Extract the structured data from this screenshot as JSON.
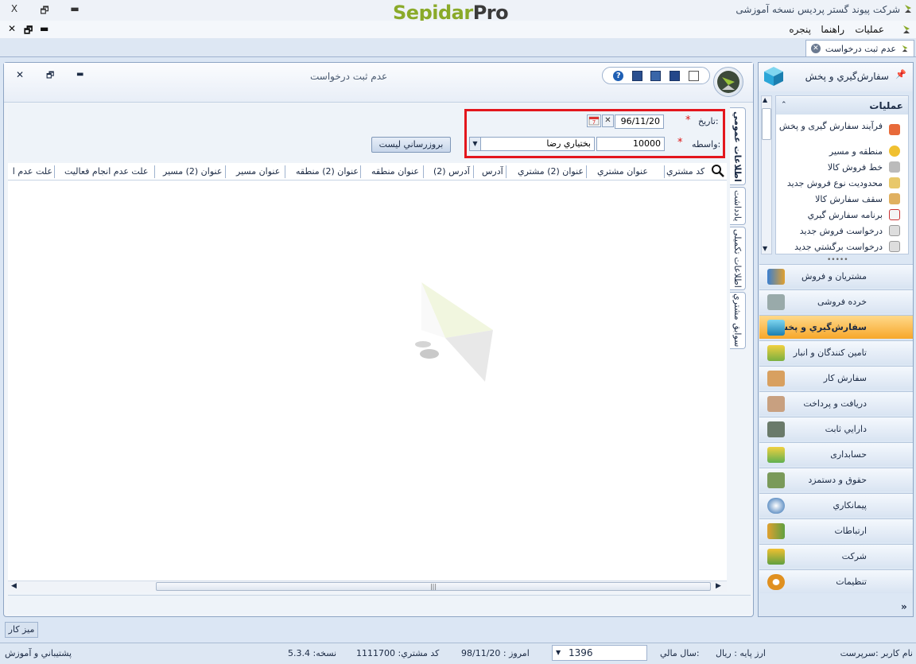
{
  "titlebar": {
    "app_title": "شرکت پیوند گستر پردیس نسخه آموزشی",
    "brand_a": "Sepidar",
    "brand_b": "Pro",
    "close": "X",
    "restore": "🗗",
    "minimize": "▬"
  },
  "menubar": {
    "items": [
      "عملیات",
      "راهنما",
      "پنجره"
    ],
    "mdi_close": "✕",
    "mdi_restore": "🗗",
    "mdi_min": "▬"
  },
  "doc_tab": {
    "label": "عدم ثبت درخواست"
  },
  "window": {
    "title": "عدم ثبت درخواست"
  },
  "filter": {
    "date_label": "تاریخ:",
    "date_value": "96/11/20",
    "agent_label": "واسطه:",
    "agent_code": "10000",
    "agent_name": "بختیاري رضا",
    "required_mark": "*",
    "refresh_button": "بروزرساني ليست"
  },
  "grid": {
    "columns": [
      "کد مشتري",
      "عنوان مشتري",
      "عنوان (2) مشتري",
      "آدرس",
      "آدرس (2)",
      "عنوان منطقه",
      "عنوان (2) منطقه",
      "عنوان مسير",
      "عنوان (2) مسير",
      "علت عدم انجام فعاليت",
      "علت عدم ا"
    ]
  },
  "vertical_tabs": [
    "اطلاعات عمومي",
    "یادداشت",
    "اطلاعات تکمیلی",
    "سوابق مشتري"
  ],
  "right_panel": {
    "title": "سفارش‌گيري و پخش",
    "pin": "📌",
    "ops_header": "عملیات",
    "ops": [
      "فرآیند سفارش گیری و پخش",
      "منطقه و مسير",
      "خط فروش کالا",
      "محدوديت نوع فروش جديد",
      "سقف سفارش کالا",
      "برنامه سفارش گيري",
      "درخواست فروش جديد",
      "درخواست برگشتي جديد"
    ],
    "nav": [
      "مشتريان و فروش",
      "خرده فروشی",
      "سفارش‌گيري و پخش",
      "تامين کنندگان و انبار",
      "سفارش کار",
      "دريافت و پرداخت",
      "دارايي ثابت",
      "حسابداری",
      "حقوق و دستمزد",
      "پيمانکاري",
      "ارتباطات",
      "شرکت",
      "تنظیمات"
    ],
    "active_nav": "سفارش‌گيري و پخش",
    "expand": "»"
  },
  "desk_button": "ميز کار",
  "statusbar": {
    "user": "نام کاربر :سرپرست",
    "currency": "ارز پايه : ريال",
    "fiscal_year_label": "سال مالي:",
    "fiscal_year": "1396",
    "today": "امروز : 98/11/20",
    "customer_code": "کد مشتري: 1111700",
    "version": "نسخه: 5.3.4",
    "support": "پشتيباني و آموزش"
  },
  "colors": {
    "accent_red": "#e3161d",
    "active_nav": "#f7a72a",
    "brand_green": "#8aaa2a"
  }
}
